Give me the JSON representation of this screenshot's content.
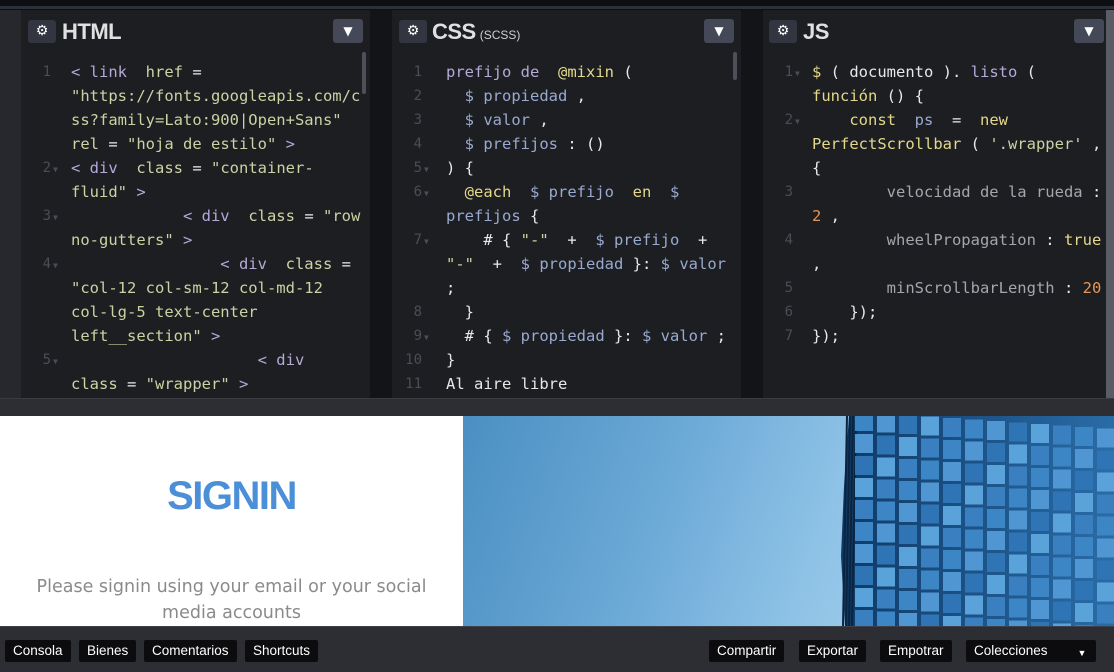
{
  "panels": {
    "html": {
      "title": "HTML",
      "sub": ""
    },
    "css": {
      "title": "CSS",
      "sub": "(SCSS)"
    },
    "js": {
      "title": "JS",
      "sub": ""
    }
  },
  "icons": {
    "gear": "gear-icon",
    "chevron": "chevron-down-icon"
  },
  "html_code": [
    {
      "num": "1",
      "fold": false,
      "indent": 0,
      "parts": [
        [
          "t",
          "< link "
        ],
        [
          "a",
          " href "
        ],
        [
          "w",
          "= "
        ]
      ]
    },
    {
      "num": "",
      "fold": false,
      "indent": 0,
      "parts": [
        [
          "s",
          "\"https://fonts.googleapis.com/c"
        ]
      ]
    },
    {
      "num": "",
      "fold": false,
      "indent": 0,
      "parts": [
        [
          "s",
          "ss?family=Lato:900|Open+Sans\""
        ]
      ]
    },
    {
      "num": "",
      "fold": false,
      "indent": 0,
      "parts": [
        [
          "a",
          "rel "
        ],
        [
          "w",
          "= "
        ],
        [
          "s",
          "\"hoja de estilo\" "
        ],
        [
          "t",
          ">"
        ]
      ]
    },
    {
      "num": "2",
      "fold": true,
      "indent": 0,
      "parts": [
        [
          "t",
          "< div "
        ],
        [
          "a",
          " class "
        ],
        [
          "w",
          "= "
        ],
        [
          "s",
          "\"container-"
        ]
      ]
    },
    {
      "num": "",
      "fold": false,
      "indent": 0,
      "parts": [
        [
          "s",
          "fluid\" "
        ],
        [
          "t",
          ">"
        ]
      ]
    },
    {
      "num": "3",
      "fold": true,
      "indent": 0,
      "parts": [
        [
          "t",
          "            < div "
        ],
        [
          "a",
          " class "
        ],
        [
          "w",
          "= "
        ],
        [
          "s",
          "\"row"
        ]
      ]
    },
    {
      "num": "",
      "fold": false,
      "indent": 0,
      "parts": [
        [
          "s",
          "no-gutters\" "
        ],
        [
          "t",
          ">"
        ]
      ]
    },
    {
      "num": "4",
      "fold": true,
      "indent": 0,
      "parts": [
        [
          "t",
          "                < div "
        ],
        [
          "a",
          " class "
        ],
        [
          "w",
          "="
        ]
      ]
    },
    {
      "num": "",
      "fold": false,
      "indent": 0,
      "parts": [
        [
          "s",
          "\"col-12 col-sm-12 col-md-12"
        ]
      ]
    },
    {
      "num": "",
      "fold": false,
      "indent": 0,
      "parts": [
        [
          "s",
          "col-lg-5 text-center"
        ]
      ]
    },
    {
      "num": "",
      "fold": false,
      "indent": 0,
      "parts": [
        [
          "s",
          "left__section\" "
        ],
        [
          "t",
          ">"
        ]
      ]
    },
    {
      "num": "5",
      "fold": true,
      "indent": 0,
      "parts": [
        [
          "t",
          "                    < div"
        ]
      ]
    },
    {
      "num": "",
      "fold": false,
      "indent": 0,
      "parts": [
        [
          "a",
          "class "
        ],
        [
          "w",
          "= "
        ],
        [
          "s",
          "\"wrapper\" "
        ],
        [
          "t",
          ">"
        ]
      ]
    }
  ],
  "css_code": [
    {
      "num": "1",
      "fold": false,
      "parts": [
        [
          "t",
          "prefijo de "
        ],
        [
          "k",
          " @mixin "
        ],
        [
          "w",
          "("
        ]
      ]
    },
    {
      "num": "2",
      "fold": false,
      "parts": [
        [
          "v",
          "  $ propiedad "
        ],
        [
          "w",
          ","
        ]
      ]
    },
    {
      "num": "3",
      "fold": false,
      "parts": [
        [
          "v",
          "  $ valor "
        ],
        [
          "w",
          ","
        ]
      ]
    },
    {
      "num": "4",
      "fold": false,
      "parts": [
        [
          "v",
          "  $ prefijos "
        ],
        [
          "w",
          ": ()"
        ]
      ]
    },
    {
      "num": "5",
      "fold": true,
      "parts": [
        [
          "w",
          ") {"
        ]
      ]
    },
    {
      "num": "6",
      "fold": true,
      "parts": [
        [
          "k",
          "  @each "
        ],
        [
          "v",
          " $ prefijo "
        ],
        [
          "k",
          " en "
        ],
        [
          "v",
          " $"
        ]
      ]
    },
    {
      "num": "",
      "fold": false,
      "parts": [
        [
          "v",
          "prefijos "
        ],
        [
          "w",
          "{"
        ]
      ]
    },
    {
      "num": "7",
      "fold": true,
      "parts": [
        [
          "w",
          "    # { "
        ],
        [
          "s",
          "\"-\" "
        ],
        [
          "w",
          " + "
        ],
        [
          "v",
          " $ prefijo "
        ],
        [
          "w",
          " +"
        ]
      ]
    },
    {
      "num": "",
      "fold": false,
      "parts": [
        [
          "s",
          "\"-\" "
        ],
        [
          "w",
          " + "
        ],
        [
          "v",
          " $ propiedad "
        ],
        [
          "w",
          "}: "
        ],
        [
          "v",
          "$ valor"
        ]
      ]
    },
    {
      "num": "",
      "fold": false,
      "parts": [
        [
          "w",
          ";"
        ]
      ]
    },
    {
      "num": "8",
      "fold": false,
      "parts": [
        [
          "w",
          "  }"
        ]
      ]
    },
    {
      "num": "9",
      "fold": true,
      "parts": [
        [
          "w",
          "  # { "
        ],
        [
          "v",
          "$ propiedad "
        ],
        [
          "w",
          "}: "
        ],
        [
          "v",
          "$ valor "
        ],
        [
          "w",
          ";"
        ]
      ]
    },
    {
      "num": "10",
      "fold": false,
      "parts": [
        [
          "w",
          "}"
        ]
      ]
    },
    {
      "num": "11",
      "fold": false,
      "parts": [
        [
          "w",
          "Al aire libre"
        ]
      ]
    }
  ],
  "js_code": [
    {
      "num": "1",
      "fold": true,
      "parts": [
        [
          "k",
          "$ "
        ],
        [
          "w",
          "( "
        ],
        [
          "w",
          "documento "
        ],
        [
          "w",
          "). "
        ],
        [
          "t",
          "listo "
        ],
        [
          "w",
          "("
        ]
      ]
    },
    {
      "num": "",
      "fold": false,
      "parts": [
        [
          "k",
          "función "
        ],
        [
          "w",
          "() {"
        ]
      ]
    },
    {
      "num": "2",
      "fold": true,
      "parts": [
        [
          "k",
          "    const "
        ],
        [
          "v",
          " ps "
        ],
        [
          "w",
          " = "
        ],
        [
          "k",
          " new"
        ]
      ]
    },
    {
      "num": "",
      "fold": false,
      "parts": [
        [
          "k",
          "PerfectScrollbar "
        ],
        [
          "w",
          "( "
        ],
        [
          "s",
          "'.wrapper' "
        ],
        [
          "w",
          ","
        ]
      ]
    },
    {
      "num": "",
      "fold": false,
      "parts": [
        [
          "w",
          "{"
        ]
      ]
    },
    {
      "num": "3",
      "fold": false,
      "parts": [
        [
          "c",
          "        velocidad de la rueda "
        ],
        [
          "w",
          ":"
        ]
      ]
    },
    {
      "num": "",
      "fold": false,
      "parts": [
        [
          "n",
          "2 "
        ],
        [
          "w",
          ","
        ]
      ]
    },
    {
      "num": "4",
      "fold": false,
      "parts": [
        [
          "c",
          "        wheelPropagation "
        ],
        [
          "w",
          ": "
        ],
        [
          "k",
          "true"
        ]
      ]
    },
    {
      "num": "",
      "fold": false,
      "parts": [
        [
          "w",
          ","
        ]
      ]
    },
    {
      "num": "5",
      "fold": false,
      "parts": [
        [
          "c",
          "        minScrollbarLength "
        ],
        [
          "w",
          ": "
        ],
        [
          "n",
          "20"
        ]
      ]
    },
    {
      "num": "6",
      "fold": false,
      "parts": [
        [
          "w",
          "    });"
        ]
      ]
    },
    {
      "num": "7",
      "fold": false,
      "parts": [
        [
          "w",
          "});"
        ]
      ]
    }
  ],
  "preview": {
    "title": "SIGNIN",
    "subtitle": "Please signin using your email or your social media accounts"
  },
  "bottombar": {
    "left": [
      "Consola",
      "Bienes",
      "Comentarios",
      "Shortcuts"
    ],
    "right": [
      "Compartir",
      "Exportar",
      "Empotrar",
      "Colecciones"
    ],
    "caret": "▼"
  }
}
